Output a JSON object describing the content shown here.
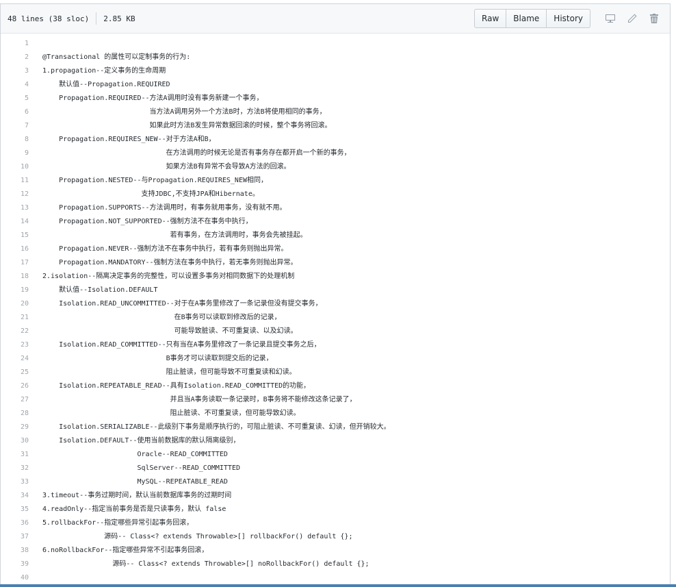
{
  "file": {
    "lines_info": "48 lines (38 sloc)",
    "size": "2.85 KB"
  },
  "toolbar": {
    "raw": "Raw",
    "blame": "Blame",
    "history": "History"
  },
  "icons": [
    "desktop-icon",
    "pencil-icon",
    "trash-icon"
  ],
  "colors": {
    "line_number": "#a0a5ab",
    "header_bg": "#f6f8fa",
    "border": "#d1d5da"
  },
  "code": [
    {
      "n": "1",
      "t": ""
    },
    {
      "n": "2",
      "t": "@Transactional 的属性可以定制事务的行为:"
    },
    {
      "n": "3",
      "t": "1.propagation--定义事务的生命周期"
    },
    {
      "n": "4",
      "t": "    默认值--Propagation.REQUIRED"
    },
    {
      "n": "5",
      "t": "    Propagation.REQUIRED--方法A调用时没有事务新建一个事务，"
    },
    {
      "n": "6",
      "t": "                          当方法A调用另外一个方法B时，方法B将使用相同的事务，"
    },
    {
      "n": "7",
      "t": "                          如果此时方法B发生异常数据回滚的时候，整个事务将回滚。"
    },
    {
      "n": "8",
      "t": "    Propagation.REQUIRES_NEW--对于方法A和B，"
    },
    {
      "n": "9",
      "t": "                              在方法调用的时候无论是否有事务存在都开启一个新的事务，"
    },
    {
      "n": "10",
      "t": "                              如果方法B有异常不会导致A方法的回滚。"
    },
    {
      "n": "11",
      "t": "    Propagation.NESTED--与Propagation.REQUIRES_NEW相同，"
    },
    {
      "n": "12",
      "t": "                        支持JDBC,不支持JPA和Hibernate。"
    },
    {
      "n": "13",
      "t": "    Propagation.SUPPORTS--方法调用时，有事务就用事务，没有就不用。"
    },
    {
      "n": "14",
      "t": "    Propagation.NOT_SUPPORTED--强制方法不在事务中执行，"
    },
    {
      "n": "15",
      "t": "                               若有事务，在方法调用时，事务会先被挂起。"
    },
    {
      "n": "16",
      "t": "    Propagation.NEVER--强制方法不在事务中执行，若有事务则抛出异常。"
    },
    {
      "n": "17",
      "t": "    Propagation.MANDATORY--强制方法在事务中执行，若无事务则抛出异常。"
    },
    {
      "n": "18",
      "t": "2.isolation--隔离决定事务的完整性，可以设置多事务对相同数据下的处理机制"
    },
    {
      "n": "19",
      "t": "    默认值--Isolation.DEFAULT"
    },
    {
      "n": "20",
      "t": "    Isolation.READ_UNCOMMITTED--对于在A事务里修改了一条记录但没有提交事务，"
    },
    {
      "n": "21",
      "t": "                                在B事务可以读取到修改后的记录，"
    },
    {
      "n": "22",
      "t": "                                可能导致脏读、不可重复读、以及幻读。"
    },
    {
      "n": "23",
      "t": "    Isolation.READ_COMMITTED--只有当在A事务里修改了一条记录且提交事务之后，"
    },
    {
      "n": "24",
      "t": "                              B事务才可以读取到提交后的记录，"
    },
    {
      "n": "25",
      "t": "                              阻止脏读，但可能导致不可重复读和幻读。"
    },
    {
      "n": "26",
      "t": "    Isolation.REPEATABLE_READ--具有Isolation.READ_COMMITTED的功能，"
    },
    {
      "n": "27",
      "t": "                               并且当A事务读取一条记录时，B事务将不能修改这条记录了，"
    },
    {
      "n": "28",
      "t": "                               阻止脏读、不可重复读，但可能导致幻读。"
    },
    {
      "n": "29",
      "t": "    Isolation.SERIALIZABLE--此级别下事务是顺序执行的，可阻止脏读、不可重复读、幻读，但开销较大。"
    },
    {
      "n": "30",
      "t": "    Isolation.DEFAULT--使用当前数据库的默认隔离级别，"
    },
    {
      "n": "31",
      "t": "                       Oracle--READ_COMMITTED"
    },
    {
      "n": "32",
      "t": "                       SqlServer--READ_COMMITTED"
    },
    {
      "n": "33",
      "t": "                       MySQL--REPEATABLE_READ"
    },
    {
      "n": "34",
      "t": "3.timeout--事务过期时间，默认当前数据库事务的过期时间"
    },
    {
      "n": "35",
      "t": "4.readOnly--指定当前事务是否是只读事务，默认 false"
    },
    {
      "n": "36",
      "t": "5.rollbackFor--指定哪些异常引起事务回滚，"
    },
    {
      "n": "37",
      "t": "               源码-- Class<? extends Throwable>[] rollbackFor() default {};"
    },
    {
      "n": "38",
      "t": "6.noRollbackFor--指定哪些异常不引起事务回滚，"
    },
    {
      "n": "39",
      "t": "                 源码-- Class<? extends Throwable>[] noRollbackFor() default {};"
    },
    {
      "n": "40",
      "t": ""
    }
  ]
}
